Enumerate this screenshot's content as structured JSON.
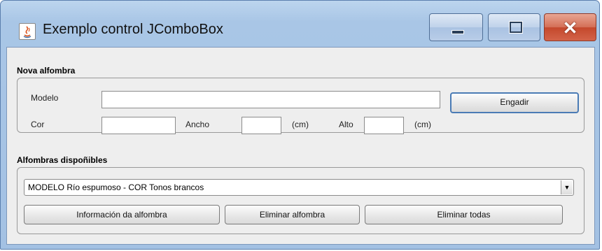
{
  "window": {
    "title": "Exemplo control JComboBox"
  },
  "new_carpet": {
    "section_title": "Nova alfombra",
    "model_label": "Modelo",
    "model_value": "",
    "color_label": "Cor",
    "color_value": "",
    "width_label": "Ancho",
    "width_value": "",
    "width_unit": "(cm)",
    "height_label": "Alto",
    "height_value": "",
    "height_unit": "(cm)",
    "add_button": "Engadir"
  },
  "available": {
    "section_title": "Alfombras dispoñibles",
    "selected": "MODELO Río espumoso - COR Tonos brancos",
    "info_button": "Información da alfombra",
    "remove_button": "Eliminar alfombra",
    "remove_all_button": "Eliminar todas"
  }
}
